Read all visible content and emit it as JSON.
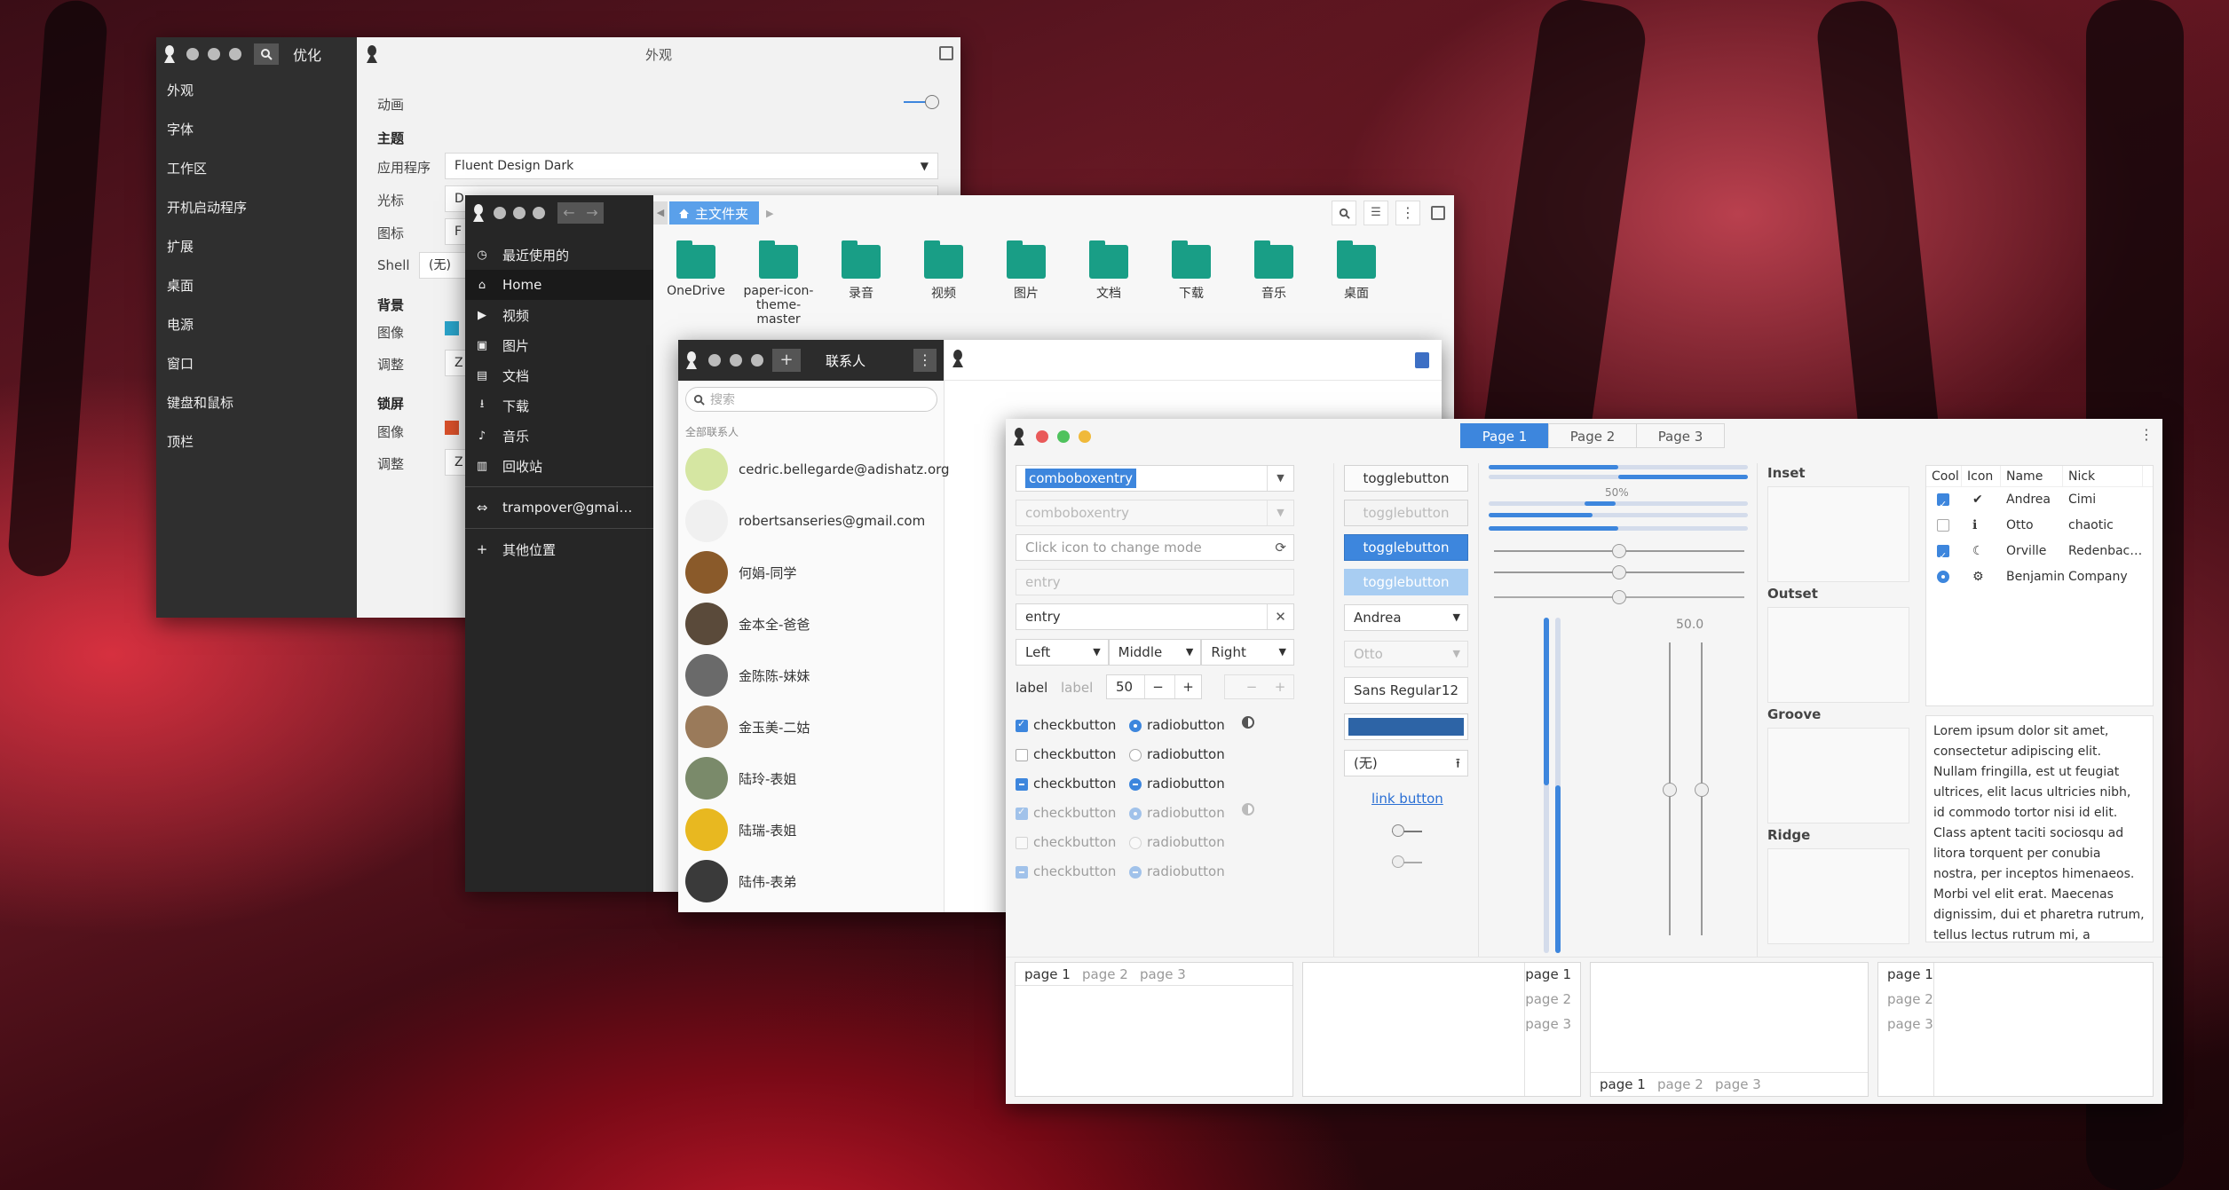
{
  "settings": {
    "app_title": "优化",
    "window_title": "外观",
    "sidebar": [
      "外观",
      "字体",
      "工作区",
      "开机启动程序",
      "扩展",
      "桌面",
      "电源",
      "窗口",
      "键盘和鼠标",
      "顶栏"
    ],
    "animation_label": "动画",
    "theme_heading": "主题",
    "apps_label": "应用程序",
    "apps_value": "Fluent Design Dark",
    "cursor_label": "光标",
    "cursor_value": "D",
    "icon_label": "图标",
    "icon_value": "F",
    "shell_label": "Shell",
    "shell_value": "(无)",
    "bg_heading": "背景",
    "bg_image_label": "图像",
    "bg_adjust_label": "调整",
    "bg_adjust_value": "Z",
    "lock_heading": "锁屏",
    "lock_image_label": "图像",
    "lock_adjust_label": "调整",
    "lock_adjust_value": "Z"
  },
  "files": {
    "breadcrumb": "主文件夹",
    "nav": [
      "最近使用的",
      "Home",
      "视频",
      "图片",
      "文档",
      "下载",
      "音乐",
      "回收站"
    ],
    "account": "trampover@gmai…",
    "other": "其他位置",
    "folders": [
      "OneDrive",
      "paper-icon-theme-master",
      "录音",
      "视频",
      "图片",
      "文档",
      "下载",
      "音乐",
      "桌面"
    ]
  },
  "contacts": {
    "title": "联系人",
    "search_placeholder": "搜索",
    "section": "全部联系人",
    "people": [
      "cedric.bellegarde@adishatz.org",
      "robertsanseries@gmail.com",
      "何娟-同学",
      "金本全-爸爸",
      "金陈陈-妹妹",
      "金玉美-二姑",
      "陆玲-表姐",
      "陆瑞-表姐",
      "陆伟-表弟"
    ],
    "avatar_colors": [
      "#d5e6a2",
      "#f0f0f0",
      "#8a5a2a",
      "#5a4a3a",
      "#6a6a6a",
      "#9a7a5a",
      "#7a8a6a",
      "#e8b820",
      "#3a3a3a"
    ]
  },
  "gtk": {
    "combo1": "comboboxentry",
    "combo2": "comboboxentry",
    "entry_hint": "Click icon to change mode",
    "entry_disabled": "entry",
    "entry_value": "entry",
    "seg": [
      "Left",
      "Middle",
      "Right"
    ],
    "label1": "label",
    "label2": "label",
    "spin_value": "50",
    "check_label": "checkbutton",
    "radio_label": "radiobutton",
    "toggle": "togglebutton",
    "combo_andrea": "Andrea",
    "combo_otto": "Otto",
    "font_name": "Sans Regular",
    "font_size": "12",
    "file_none": "(无)",
    "link": "link button",
    "progress_pct": "50%",
    "scale_value": "50.0",
    "tabs": [
      "Page 1",
      "Page 2",
      "Page 3"
    ],
    "frames": [
      "Inset",
      "Outset",
      "Groove",
      "Ridge"
    ],
    "tree_headers": [
      "Cool",
      "Icon",
      "Name",
      "Nick"
    ],
    "tree_rows": [
      {
        "name": "Andrea",
        "nick": "Cimi"
      },
      {
        "name": "Otto",
        "nick": "chaotic"
      },
      {
        "name": "Orville",
        "nick": "Redenbac…"
      },
      {
        "name": "Benjamin",
        "nick": "Company"
      }
    ],
    "lorem": "Lorem ipsum dolor sit amet, consectetur adipiscing elit. Nullam fringilla, est ut feugiat ultrices, elit lacus ultricies nibh, id commodo tortor nisi id elit. Class aptent taciti sociosqu ad litora torquent per conubia nostra, per inceptos himenaeos. Morbi vel elit erat. Maecenas dignissim, dui et pharetra rutrum, tellus lectus rutrum mi, a",
    "nb_tabs": [
      "page 1",
      "page 2",
      "page 3"
    ],
    "progress_fraction": 0.5
  }
}
